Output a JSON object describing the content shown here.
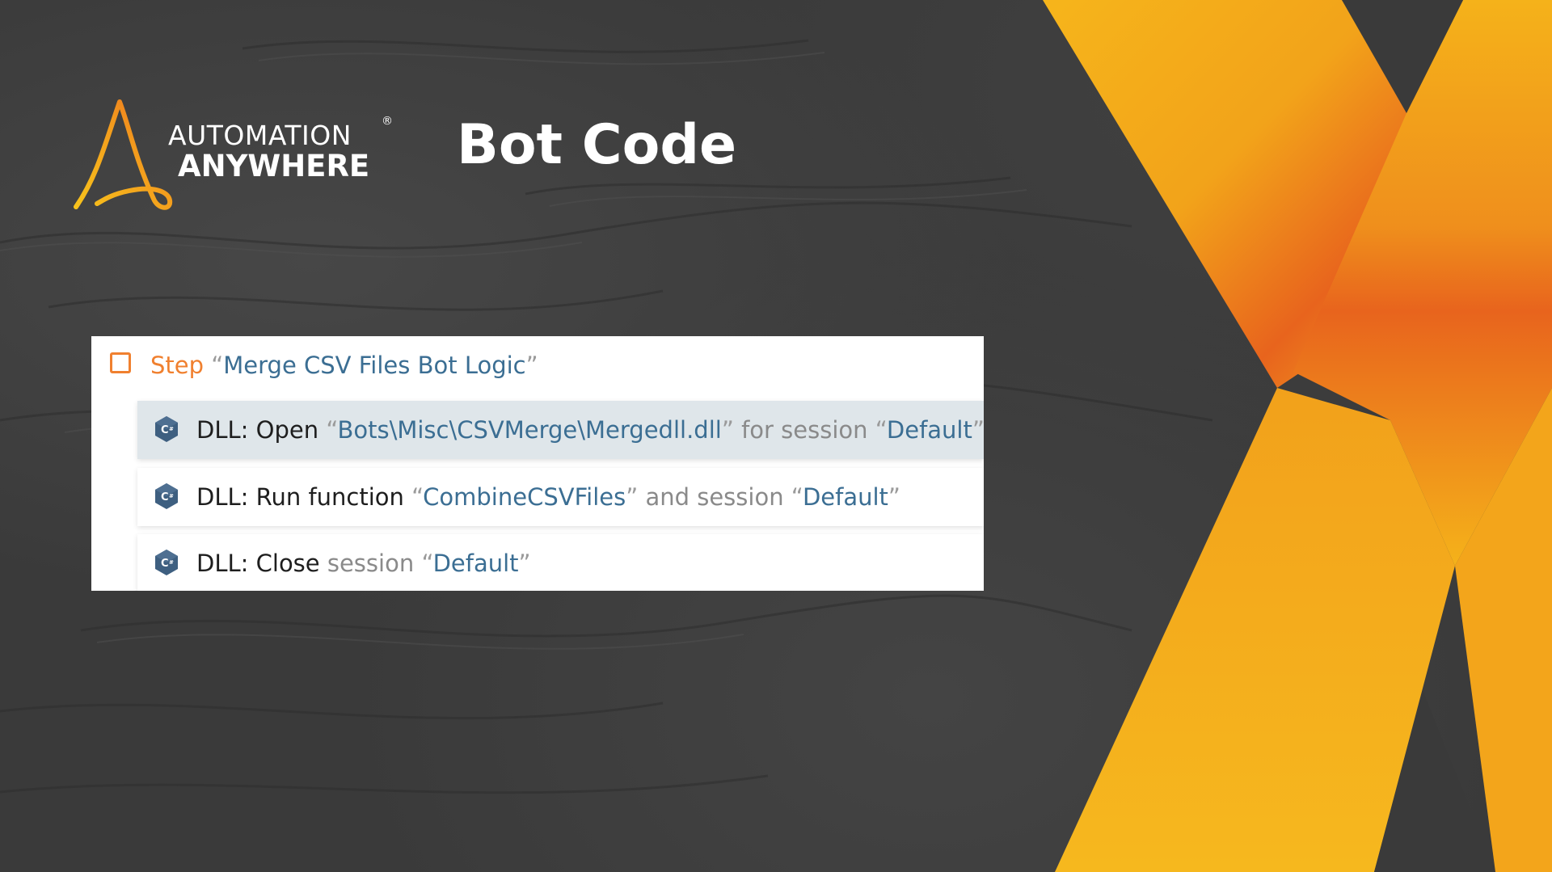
{
  "brand": {
    "line1": "AUTOMATION",
    "line2": "ANYWHERE",
    "registered": "®",
    "colors": {
      "orange": "#f0802f",
      "yellow": "#f5b018",
      "dark_orange": "#e8641d",
      "background": "#3a3a3a"
    }
  },
  "title": "Bot Code",
  "step": {
    "keyword": "Step",
    "open_quote": "“",
    "name": "Merge CSV Files Bot Logic",
    "close_quote": "”"
  },
  "actions": [
    {
      "command": "DLL: Open",
      "q1": "“",
      "value1": "Bots\\Misc\\CSVMerge\\Mergedll.dll",
      "q2": "”",
      "mid": " for session ",
      "q3": "“",
      "value2": "Default",
      "q4": "”",
      "icon": "csharp-icon",
      "selected": true
    },
    {
      "command": "DLL: Run function",
      "q1": "“",
      "value1": "CombineCSVFiles",
      "q2": "”",
      "mid": " and session ",
      "q3": "“",
      "value2": "Default",
      "q4": "”",
      "icon": "csharp-icon",
      "selected": false
    },
    {
      "command": "DLL: Close",
      "mid": " session ",
      "q3": "“",
      "value2": "Default",
      "q4": "”",
      "icon": "csharp-icon",
      "selected": false
    }
  ]
}
